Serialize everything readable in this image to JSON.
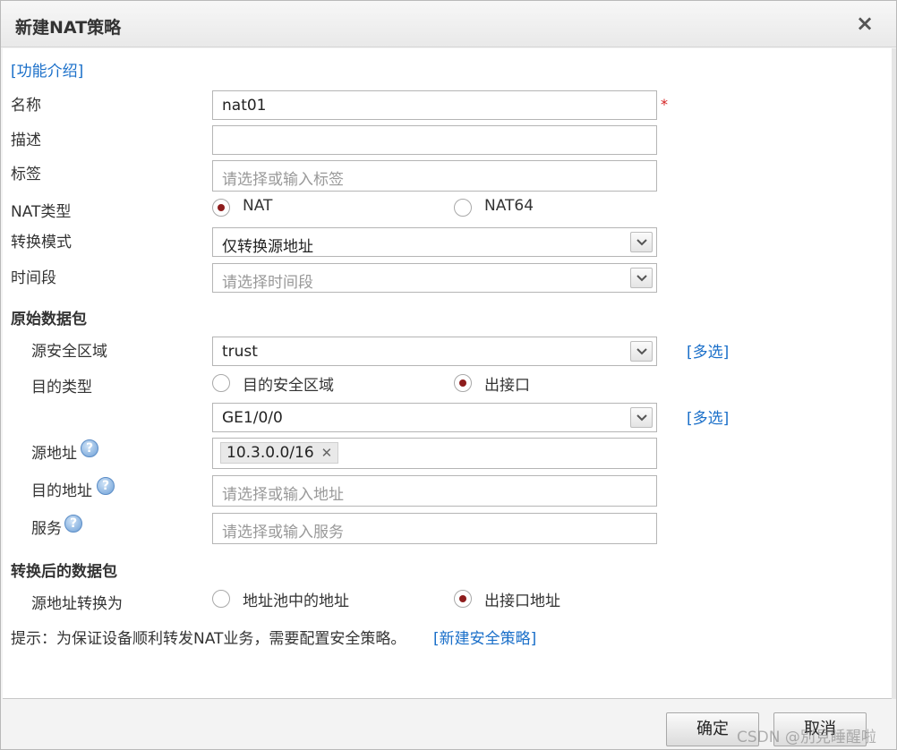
{
  "dialog": {
    "title": "新建NAT策略",
    "close_symbol": "×"
  },
  "intro_link": "[功能介绍]",
  "form": {
    "name": {
      "label": "名称",
      "value": "nat01",
      "required_mark": "*"
    },
    "description": {
      "label": "描述",
      "value": ""
    },
    "tag": {
      "label": "标签",
      "placeholder": "请选择或输入标签"
    },
    "nat_type": {
      "label": "NAT类型",
      "options": [
        {
          "label": "NAT",
          "selected": true
        },
        {
          "label": "NAT64",
          "selected": false
        }
      ]
    },
    "convert_mode": {
      "label": "转换模式",
      "value": "仅转换源地址"
    },
    "time_range": {
      "label": "时间段",
      "placeholder": "请选择时间段"
    }
  },
  "original_packet": {
    "heading": "原始数据包",
    "source_zone": {
      "label": "源安全区域",
      "value": "trust",
      "multi_link": "[多选]"
    },
    "dest_type": {
      "label": "目的类型",
      "options": [
        {
          "label": "目的安全区域",
          "selected": false
        },
        {
          "label": "出接口",
          "selected": true
        }
      ]
    },
    "interface": {
      "value": "GE1/0/0",
      "multi_link": "[多选]"
    },
    "source_address": {
      "label": "源地址",
      "help": "?",
      "tag": "10.3.0.0/16",
      "tag_remove": "✕"
    },
    "dest_address": {
      "label": "目的地址",
      "help": "?",
      "placeholder": "请选择或输入地址"
    },
    "service": {
      "label": "服务",
      "help": "?",
      "placeholder": "请选择或输入服务"
    }
  },
  "translated_packet": {
    "heading": "转换后的数据包",
    "source_translate": {
      "label": "源地址转换为",
      "options": [
        {
          "label": "地址池中的地址",
          "selected": false
        },
        {
          "label": "出接口地址",
          "selected": true
        }
      ]
    }
  },
  "hint": {
    "text": "提示：为保证设备顺利转发NAT业务，需要配置安全策略。",
    "link": "[新建安全策略]"
  },
  "buttons": {
    "ok": "确定",
    "cancel": "取消"
  },
  "watermark": "CSDN @別見睡醒啦",
  "colors": {
    "link": "#1a6fc9",
    "radio_selected": "#8e1d1d",
    "required": "#d42020"
  }
}
